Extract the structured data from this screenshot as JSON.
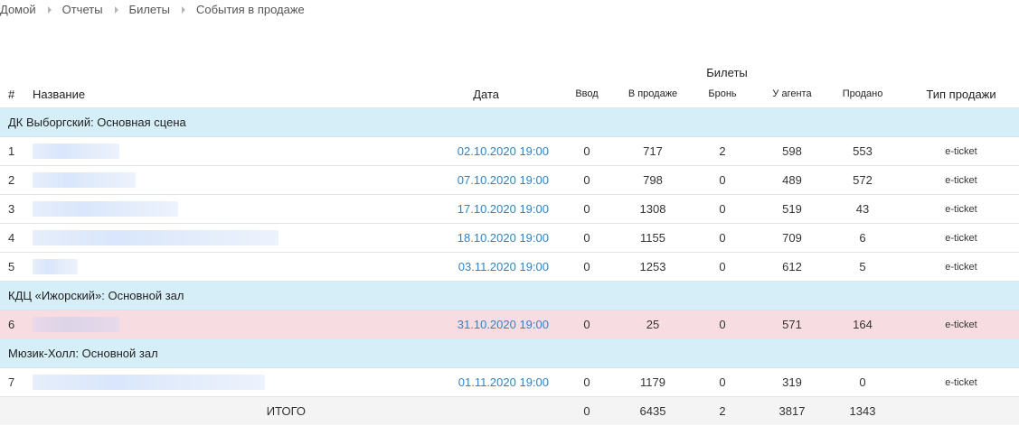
{
  "breadcrumb": [
    "Домой",
    "Отчеты",
    "Билеты",
    "События в продаже"
  ],
  "table": {
    "group_header": "Билеты",
    "headers": {
      "num": "#",
      "name": "Название",
      "date": "Дата",
      "entry": "Ввод",
      "on_sale": "В продаже",
      "reserved": "Бронь",
      "agent": "У агента",
      "sold": "Продано",
      "sale_type": "Тип продажи"
    },
    "groups": [
      {
        "venue": "ДК Выборгский: Основная сцена",
        "rows": [
          {
            "num": "1",
            "date": "02.10.2020 19:00",
            "entry": "0",
            "on_sale": "717",
            "reserved": "2",
            "agent": "598",
            "sold": "553",
            "type": "e-ticket",
            "redacted_fraction": 0.33
          },
          {
            "num": "2",
            "date": "07.10.2020 19:00",
            "entry": "0",
            "on_sale": "798",
            "reserved": "0",
            "agent": "489",
            "sold": "572",
            "type": "e-ticket",
            "redacted_fraction": 0.39
          },
          {
            "num": "3",
            "date": "17.10.2020 19:00",
            "entry": "0",
            "on_sale": "1308",
            "reserved": "0",
            "agent": "519",
            "sold": "43",
            "type": "e-ticket",
            "redacted_fraction": 0.55
          },
          {
            "num": "4",
            "date": "18.10.2020 19:00",
            "entry": "0",
            "on_sale": "1155",
            "reserved": "0",
            "agent": "709",
            "sold": "6",
            "type": "e-ticket",
            "redacted_fraction": 0.93
          },
          {
            "num": "5",
            "date": "03.11.2020 19:00",
            "entry": "0",
            "on_sale": "1253",
            "reserved": "0",
            "agent": "612",
            "sold": "5",
            "type": "e-ticket",
            "redacted_fraction": 0.17
          }
        ]
      },
      {
        "venue": "КДЦ «Ижорский»: Основной зал",
        "rows": [
          {
            "num": "6",
            "date": "31.10.2020 19:00",
            "entry": "0",
            "on_sale": "25",
            "reserved": "0",
            "agent": "571",
            "sold": "164",
            "type": "e-ticket",
            "highlight": true,
            "redacted_fraction": 0.33
          }
        ]
      },
      {
        "venue": "Мюзик-Холл: Основной зал",
        "rows": [
          {
            "num": "7",
            "date": "01.11.2020 19:00",
            "entry": "0",
            "on_sale": "1179",
            "reserved": "0",
            "agent": "319",
            "sold": "0",
            "type": "e-ticket",
            "redacted_fraction": 0.88
          }
        ]
      }
    ],
    "total": {
      "label": "ИТОГО",
      "entry": "0",
      "on_sale": "6435",
      "reserved": "2",
      "agent": "3817",
      "sold": "1343"
    }
  },
  "colors": {
    "date_link": "#2f84c8",
    "venue_bg": "#d6eef7",
    "highlight_bg": "#f7dde1",
    "total_bg": "#f4f4f4"
  }
}
